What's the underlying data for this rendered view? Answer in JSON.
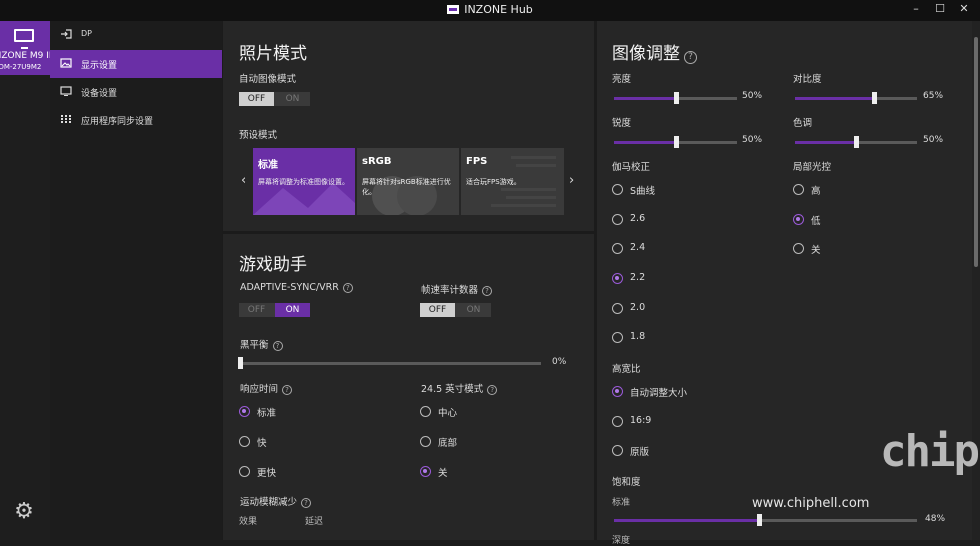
{
  "window": {
    "title": "INZONE Hub",
    "minimize": "–",
    "maximize": "☐",
    "close": "✕"
  },
  "device": {
    "name": "INZONE M9 II",
    "model": "SDM-27U9M2"
  },
  "nav": {
    "input_label": "DP",
    "items": [
      {
        "label": "显示设置",
        "icon": "image-icon"
      },
      {
        "label": "设备设置",
        "icon": "monitor-icon"
      },
      {
        "label": "应用程序同步设置",
        "icon": "apps-grid-icon"
      }
    ]
  },
  "picture_mode": {
    "title": "照片模式",
    "auto_label": "自动图像模式",
    "off": "OFF",
    "on": "ON",
    "preset_label": "预设模式",
    "presets": [
      {
        "title": "标准",
        "desc": "屏幕将调整为标准图像设置。"
      },
      {
        "title": "sRGB",
        "desc": "屏幕将针对sRGB标准进行优化。"
      },
      {
        "title": "FPS",
        "desc": "适合玩FPS游戏。"
      }
    ]
  },
  "game_assist": {
    "title": "游戏助手",
    "adaptive_sync": "ADAPTIVE-SYNC/VRR",
    "fps_counter": "帧速率计数器",
    "black_equalizer": "黑平衡",
    "black_equalizer_value": "0%",
    "response_time": "响应时间",
    "response_options": [
      "标准",
      "快",
      "更快"
    ],
    "mode_245": "24.5 英寸模式",
    "mode_245_options": [
      "中心",
      "底部",
      "关"
    ],
    "motion_blur": "运动模糊减少",
    "motion_blur_cols": [
      "效果",
      "延迟"
    ]
  },
  "image_adjust": {
    "title": "图像调整",
    "brightness": "亮度",
    "brightness_value": "50%",
    "contrast": "对比度",
    "contrast_value": "65%",
    "sharpness": "锐度",
    "sharpness_value": "50%",
    "hue": "色调",
    "hue_value": "50%",
    "gamma": "伽马校正",
    "gamma_options": [
      "S曲线",
      "2.6",
      "2.4",
      "2.2",
      "2.0",
      "1.8"
    ],
    "local_dimming": "局部光控",
    "dimming_options": [
      "高",
      "低",
      "关"
    ],
    "aspect": "高宽比",
    "aspect_options": [
      "自动调整大小",
      "16:9",
      "原版"
    ],
    "saturation": "饱和度",
    "saturation_sub": "标准",
    "saturation_value": "48%",
    "next_sub": "深度"
  },
  "levels": {
    "brightness": 50,
    "contrast": 65,
    "sharpness": 50,
    "hue": 50,
    "saturation": 48,
    "black_equalizer": 0
  },
  "watermark": {
    "text": "www.chiphell.com",
    "logo": "chip hell"
  },
  "colors": {
    "accent": "#6a2fa6",
    "panel": "#262626",
    "background": "#1b1b1b"
  }
}
